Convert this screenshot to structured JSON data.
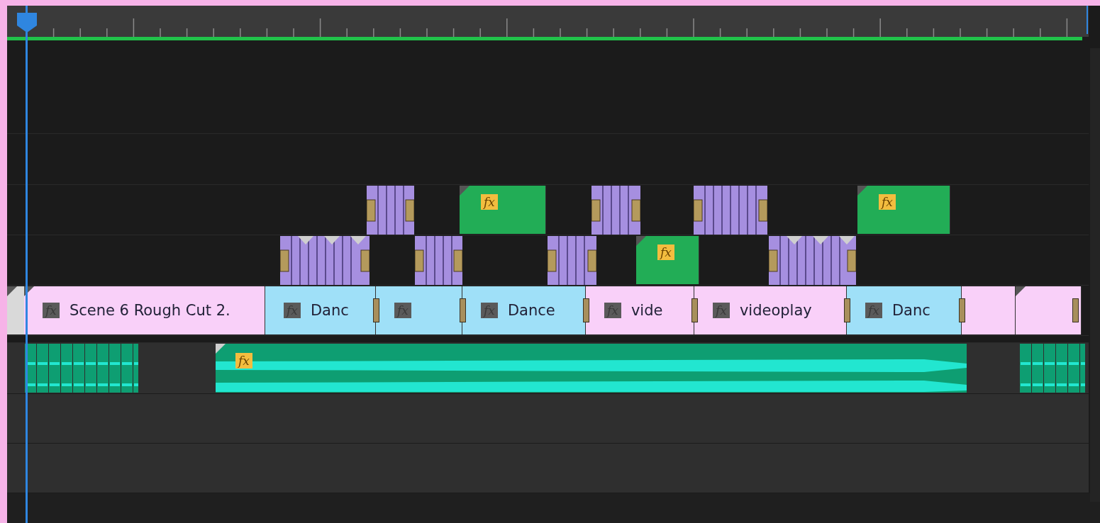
{
  "tracks": [
    {
      "kind": "empty"
    },
    {
      "kind": "empty"
    },
    {
      "kind": "video",
      "clips": [
        {
          "kind": "stripes",
          "color": "#a68fe0"
        },
        {
          "kind": "solid",
          "color": "#22ad56",
          "fx": {
            "label": "fx",
            "active": true
          }
        },
        {
          "kind": "stripes",
          "color": "#a68fe0"
        },
        {
          "kind": "stripes",
          "color": "#a68fe0"
        },
        {
          "kind": "solid",
          "color": "#22ad56",
          "fx": {
            "label": "fx",
            "active": true
          }
        }
      ]
    },
    {
      "kind": "video",
      "clips": [
        {
          "kind": "stripes",
          "color": "#a68fe0"
        },
        {
          "kind": "stripes",
          "color": "#a68fe0"
        },
        {
          "kind": "stripes",
          "color": "#a68fe0"
        },
        {
          "kind": "solid",
          "color": "#22ad56",
          "fx": {
            "label": "fx",
            "active": true
          }
        },
        {
          "kind": "stripes",
          "color": "#a68fe0"
        }
      ]
    },
    {
      "kind": "video",
      "clips": [
        {
          "kind": "solid",
          "color": "#d9d9d9"
        },
        {
          "kind": "solid",
          "color": "#f9d0f9",
          "fx": {
            "label": "fx",
            "active": false
          },
          "label": "Scene 6 Rough Cut 2."
        },
        {
          "kind": "solid",
          "color": "#9fe0f8",
          "fx": {
            "label": "fx",
            "active": false
          },
          "label": "Danc"
        },
        {
          "kind": "solid",
          "color": "#9fe0f8",
          "fx": {
            "label": "fx",
            "active": false
          }
        },
        {
          "kind": "solid",
          "color": "#9fe0f8",
          "fx": {
            "label": "fx",
            "active": false
          },
          "label": "Dance"
        },
        {
          "kind": "solid",
          "color": "#f9d0f9",
          "fx": {
            "label": "fx",
            "active": false
          },
          "label": "vide"
        },
        {
          "kind": "solid",
          "color": "#f9d0f9",
          "fx": {
            "label": "fx",
            "active": false
          },
          "label": "videoplay"
        },
        {
          "kind": "solid",
          "color": "#9fe0f8",
          "fx": {
            "label": "fx",
            "active": false
          },
          "label": "Danc"
        },
        {
          "kind": "solid",
          "color": "#f9d0f9"
        },
        {
          "kind": "solid",
          "color": "#f9d0f9"
        }
      ]
    },
    {
      "kind": "gap"
    },
    {
      "kind": "audio",
      "clips": [
        {
          "kind": "segments",
          "color": "#0e9e72"
        },
        {
          "kind": "wave",
          "color": "#0e9e72",
          "fx": {
            "label": "fx",
            "active": true
          }
        },
        {
          "kind": "segments",
          "color": "#0e9e72"
        }
      ]
    },
    {
      "kind": "audio_empty"
    },
    {
      "kind": "audio_empty"
    }
  ]
}
